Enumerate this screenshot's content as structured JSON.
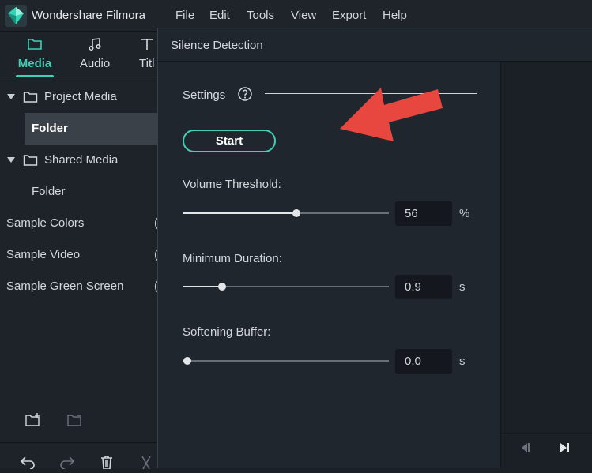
{
  "app": {
    "title": "Wondershare Filmora",
    "logo_icon": "filmora-logo-icon",
    "accent_color": "#3fd0b6"
  },
  "menu": [
    "File",
    "Edit",
    "Tools",
    "View",
    "Export",
    "Help"
  ],
  "left_panel": {
    "tabs": [
      {
        "label": "Media",
        "icon": "folder-icon",
        "active": true
      },
      {
        "label": "Audio",
        "icon": "music-note-icon",
        "active": false
      },
      {
        "label": "Titl",
        "icon": "title-t-icon",
        "active": false
      }
    ],
    "tree": [
      {
        "label": "Project Media",
        "expandable": true
      },
      {
        "label": "Folder",
        "selected": true
      },
      {
        "label": "Shared Media",
        "expandable": true
      },
      {
        "label": "Folder"
      },
      {
        "label": "Sample Colors"
      },
      {
        "label": "Sample Video"
      },
      {
        "label": "Sample Green Screen"
      }
    ],
    "bottom_icons": [
      "new-folder-icon",
      "remove-folder-icon"
    ],
    "toolbar_icons": [
      "undo-icon",
      "redo-icon",
      "delete-icon",
      "cut-icon"
    ]
  },
  "dialog": {
    "title": "Silence Detection",
    "settings_label": "Settings",
    "help_icon": "help-circle-icon",
    "start_label": "Start",
    "params": [
      {
        "label": "Volume Threshold:",
        "value": "56",
        "unit": "%",
        "level": 0.55
      },
      {
        "label": "Minimum Duration:",
        "value": "0.9",
        "unit": "s",
        "level": 0.19
      },
      {
        "label": "Softening Buffer:",
        "value": "0.0",
        "unit": "s",
        "level": 0.02
      }
    ],
    "preview_controls": [
      "previous-frame-icon",
      "play-icon"
    ],
    "annotation_color": "#e8473f"
  }
}
